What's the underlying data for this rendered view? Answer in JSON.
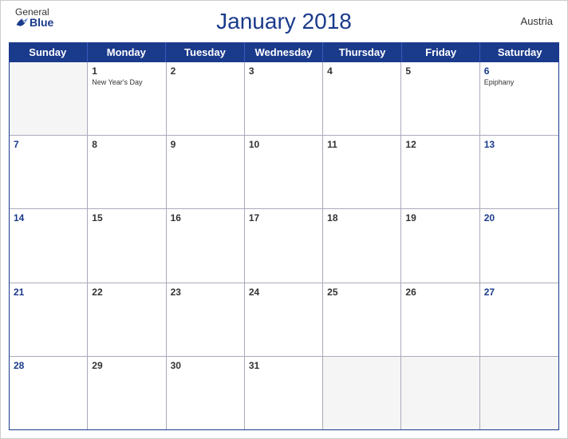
{
  "header": {
    "title": "January 2018",
    "country": "Austria",
    "logo": {
      "general": "General",
      "blue": "Blue"
    }
  },
  "days_of_week": [
    "Sunday",
    "Monday",
    "Tuesday",
    "Wednesday",
    "Thursday",
    "Friday",
    "Saturday"
  ],
  "weeks": [
    [
      {
        "num": "",
        "empty": true
      },
      {
        "num": "1",
        "holiday": "New Year's Day"
      },
      {
        "num": "2"
      },
      {
        "num": "3"
      },
      {
        "num": "4"
      },
      {
        "num": "5"
      },
      {
        "num": "6",
        "holiday": "Epiphany"
      }
    ],
    [
      {
        "num": "7"
      },
      {
        "num": "8"
      },
      {
        "num": "9"
      },
      {
        "num": "10"
      },
      {
        "num": "11"
      },
      {
        "num": "12"
      },
      {
        "num": "13"
      }
    ],
    [
      {
        "num": "14"
      },
      {
        "num": "15"
      },
      {
        "num": "16"
      },
      {
        "num": "17"
      },
      {
        "num": "18"
      },
      {
        "num": "19"
      },
      {
        "num": "20"
      }
    ],
    [
      {
        "num": "21"
      },
      {
        "num": "22"
      },
      {
        "num": "23"
      },
      {
        "num": "24"
      },
      {
        "num": "25"
      },
      {
        "num": "26"
      },
      {
        "num": "27"
      }
    ],
    [
      {
        "num": "28"
      },
      {
        "num": "29"
      },
      {
        "num": "30"
      },
      {
        "num": "31"
      },
      {
        "num": "",
        "empty": true
      },
      {
        "num": "",
        "empty": true
      },
      {
        "num": "",
        "empty": true
      }
    ]
  ]
}
